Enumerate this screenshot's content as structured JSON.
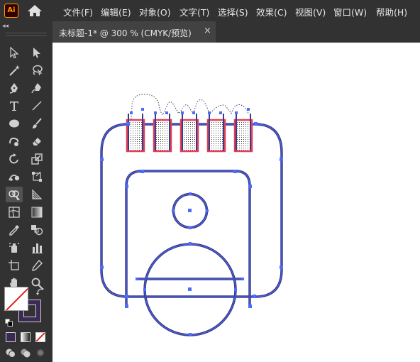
{
  "app": {
    "logo_text": "Ai"
  },
  "menu": [
    {
      "label": "文件(F)"
    },
    {
      "label": "编辑(E)"
    },
    {
      "label": "对象(O)"
    },
    {
      "label": "文字(T)"
    },
    {
      "label": "选择(S)"
    },
    {
      "label": "效果(C)"
    },
    {
      "label": "视图(V)"
    },
    {
      "label": "窗口(W)"
    },
    {
      "label": "帮助(H)"
    }
  ],
  "document_tab": {
    "title": "未标题-1* @ 300 % (CMYK/预览)",
    "close": "×"
  },
  "toolbar": {
    "collapse": "◂◂"
  },
  "colors": {
    "stroke": "#3b3a84",
    "selection": "#4a6cff",
    "highlight": "#e0405a",
    "fill_swatch": "#ffffff",
    "stroke_swatch": "#3a2a55",
    "chrome": "#323232"
  }
}
